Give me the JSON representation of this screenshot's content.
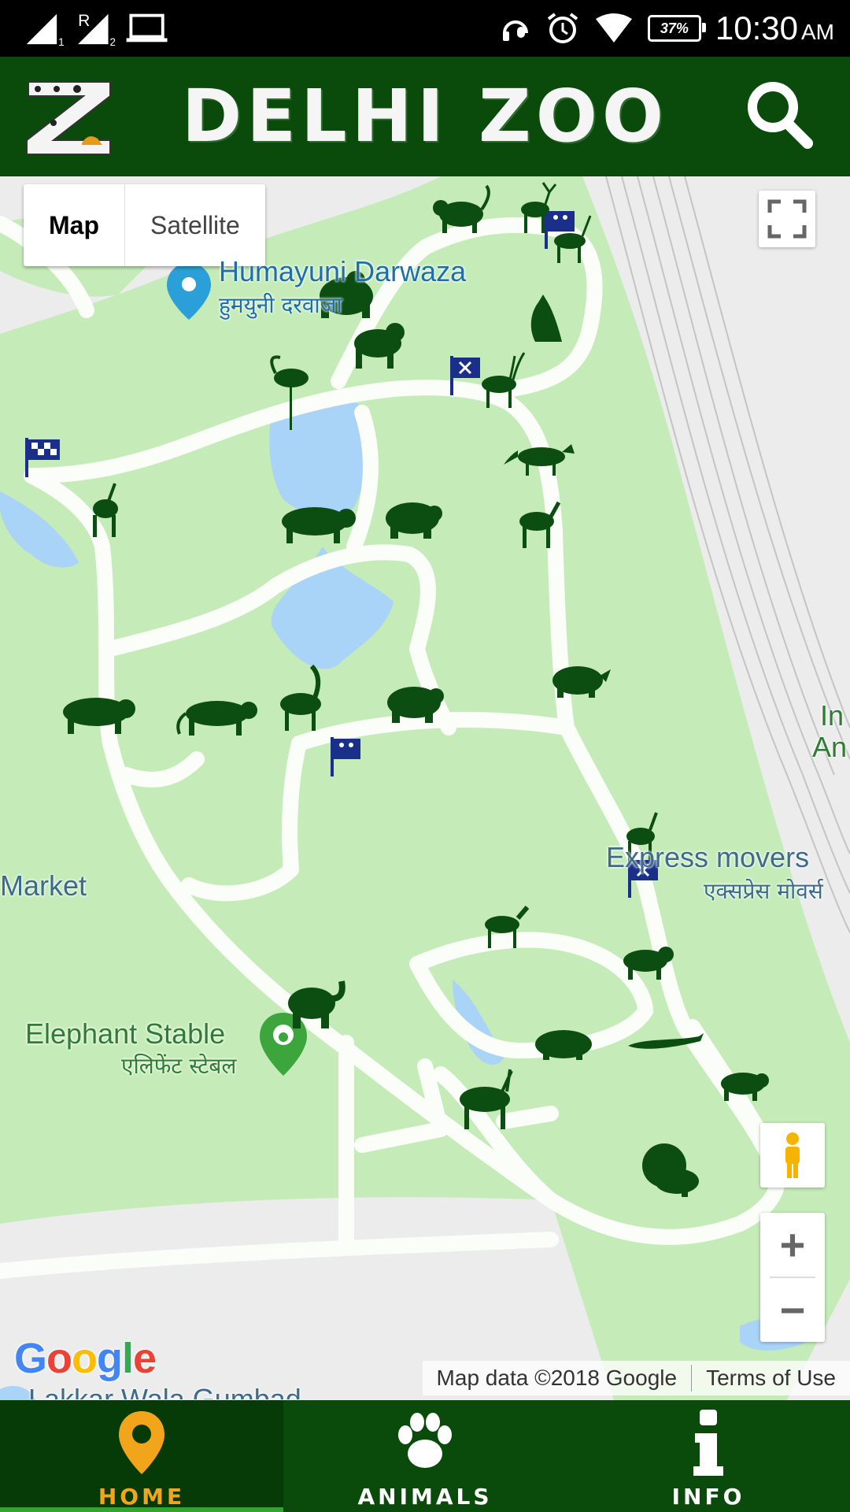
{
  "status_bar": {
    "time": "10:30",
    "ampm": "AM",
    "battery": "37%",
    "sim1": "1",
    "sim2": "2",
    "roaming": "R"
  },
  "header": {
    "title": "DELHI ZOO"
  },
  "map": {
    "type_options": [
      "Map",
      "Satellite"
    ],
    "selected_type": "Map",
    "labels": {
      "humayuni_en": "Humayuni Darwaza",
      "humayuni_hi": "हुमयुनी दरवाजा",
      "market": "Market",
      "express_en": "Express movers",
      "express_hi": "एक्सप्रेस मोवर्स",
      "elephant_en": "Elephant Stable",
      "elephant_hi": "एलिफेंट स्टेबल",
      "lakkar": "Lakkar Wala Gumbad",
      "right_edge_1": "In",
      "right_edge_2": "An"
    },
    "zoom_in": "+",
    "zoom_out": "−",
    "google": "Google",
    "attribution": "Map data ©2018 Google",
    "terms": "Terms of Use"
  },
  "bottom_nav": {
    "items": [
      {
        "label": "HOME",
        "icon": "map-pin-icon",
        "active": true
      },
      {
        "label": "ANIMALS",
        "icon": "paw-icon",
        "active": false
      },
      {
        "label": "INFO",
        "icon": "info-icon",
        "active": false
      }
    ]
  },
  "colors": {
    "header_green": "#0a4a0b",
    "map_green": "#c5ecb8",
    "active_orange": "#f2a51a",
    "animal_green": "#0c4d12",
    "flag_blue": "#1a2f8a"
  }
}
